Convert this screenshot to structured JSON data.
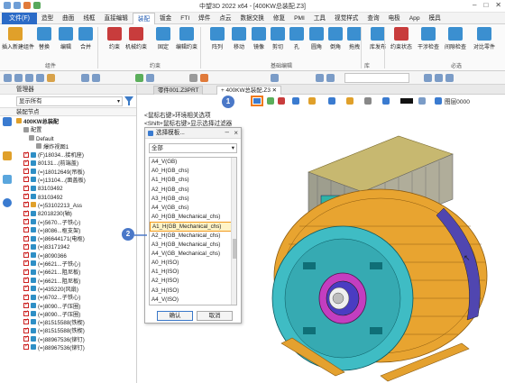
{
  "window": {
    "title": "中望3D 2022 x64 - [400KW总装配.Z3]"
  },
  "menubar": {
    "file": "文件(F)",
    "items": [
      "造型",
      "曲面",
      "线框",
      "直接编辑",
      "装配",
      "钣金",
      "FTI",
      "焊件",
      "点云",
      "数据交换",
      "修复",
      "PMI",
      "工具",
      "视觉样式",
      "查询",
      "电极",
      "App",
      "模具"
    ],
    "active_index": 4
  },
  "ribbon": {
    "buttons": [
      {
        "label": "插入新建组件",
        "icon": "insert-component-icon",
        "color": "#e0a02a"
      },
      {
        "label": "替换",
        "icon": "replace-icon",
        "color": "#3b8fd0"
      },
      {
        "label": "编辑",
        "icon": "edit-icon",
        "color": "#3b8fd0"
      },
      {
        "label": "合并",
        "icon": "merge-icon",
        "color": "#3b8fd0"
      },
      {
        "label": "约束",
        "icon": "constraint-icon",
        "color": "#c83c3c"
      },
      {
        "label": "机械约束",
        "icon": "mechanical-constraint-icon",
        "color": "#c83c3c"
      },
      {
        "label": "固定",
        "icon": "fix-icon",
        "color": "#3b8fd0"
      },
      {
        "label": "编辑约束",
        "icon": "edit-constraint-icon",
        "color": "#3b8fd0"
      },
      {
        "label": "阵列",
        "icon": "pattern-icon",
        "color": "#3b8fd0"
      },
      {
        "label": "移动",
        "icon": "move-icon",
        "color": "#3b8fd0"
      },
      {
        "label": "镜像",
        "icon": "mirror-icon",
        "color": "#3b8fd0"
      },
      {
        "label": "剪切",
        "icon": "cut-icon",
        "color": "#3b8fd0"
      },
      {
        "label": "孔",
        "icon": "hole-icon",
        "color": "#3b8fd0"
      },
      {
        "label": "圆角",
        "icon": "fillet-icon",
        "color": "#3b8fd0"
      },
      {
        "label": "倒角",
        "icon": "chamfer-icon",
        "color": "#3b8fd0"
      },
      {
        "label": "拖拽",
        "icon": "drag-icon",
        "color": "#3b8fd0"
      },
      {
        "label": "库发布",
        "icon": "library-publish-icon",
        "color": "#3b8fd0"
      },
      {
        "label": "约束状态",
        "icon": "constraint-status-icon",
        "color": "#c83c3c"
      },
      {
        "label": "干涉检查",
        "icon": "interference-check-icon",
        "color": "#3b8fd0"
      },
      {
        "label": "间隙检查",
        "icon": "clearance-check-icon",
        "color": "#3b8fd0"
      },
      {
        "label": "对比零件",
        "icon": "compare-parts-icon",
        "color": "#3b8fd0"
      }
    ],
    "groups": [
      "组件",
      "约束",
      "基础编辑",
      "库",
      "必选"
    ]
  },
  "panel": {
    "title": "管理器",
    "filter_value": "显示所有",
    "node_header": "装配节点",
    "tree": [
      {
        "label": "400KW总装配",
        "kind": "root"
      },
      {
        "label": "配置",
        "kind": "cfg"
      },
      {
        "label": "Default",
        "kind": "cfg"
      },
      {
        "label": "爆炸视图1",
        "kind": "cfg"
      },
      {
        "label": "(F)18034...接机座)",
        "kind": "part"
      },
      {
        "label": "80131...(前端盖)",
        "kind": "part"
      },
      {
        "label": "(=)18012649(吊板)",
        "kind": "part"
      },
      {
        "label": "(=)13104...(面盖板)",
        "kind": "part"
      },
      {
        "label": "83103492",
        "kind": "part"
      },
      {
        "label": "83103492",
        "kind": "part"
      },
      {
        "label": "(=)53102213_Ass",
        "kind": "asm"
      },
      {
        "label": "82018230(轴)",
        "kind": "part"
      },
      {
        "label": "(=)5670...子铁心)",
        "kind": "part"
      },
      {
        "label": "(=)8086...枢支架)",
        "kind": "part"
      },
      {
        "label": "(=)86644171(电枢)",
        "kind": "part"
      },
      {
        "label": "(=)83171942",
        "kind": "part"
      },
      {
        "label": "(=)8090366",
        "kind": "part"
      },
      {
        "label": "(=)6621...子铁心)",
        "kind": "part"
      },
      {
        "label": "(=)6621...阻尼板)",
        "kind": "part"
      },
      {
        "label": "(=)6621...阻尼板)",
        "kind": "part"
      },
      {
        "label": "(=)435220(风扇)",
        "kind": "part"
      },
      {
        "label": "(=)6702...子铁心)",
        "kind": "part"
      },
      {
        "label": "(=)8090...子压圈)",
        "kind": "part"
      },
      {
        "label": "(=)8090...子压圈)",
        "kind": "part"
      },
      {
        "label": "(=)81515588(铁楔)",
        "kind": "part"
      },
      {
        "label": "(=)81515588(铁楔)",
        "kind": "part"
      },
      {
        "label": "(=)88967536(铆钉)",
        "kind": "part"
      },
      {
        "label": "(=)88967536(铆钉)",
        "kind": "part"
      }
    ]
  },
  "tabs": [
    {
      "label": "零件001.Z3PRT",
      "active": false
    },
    {
      "label": "400KW总装配.Z3",
      "active": true
    }
  ],
  "viewport": {
    "hint1": "<鼠标右键>环境相关选项",
    "hint2": "<Shift+鼠标右键>显示选择过滤器",
    "layer_label": "图层0000",
    "cursor_glyph": "↖"
  },
  "dialog": {
    "title": "选择模板...",
    "filter_value": "全部",
    "items": [
      "A4_V(GB)",
      "A0_H(GB_chs)",
      "A1_H(GB_chs)",
      "A2_H(GB_chs)",
      "A3_H(GB_chs)",
      "A4_V(GB_chs)",
      "A0_H(GB_Mechanical_chs)",
      "A1_H(GB_Mechanical_chs)",
      "A2_H(GB_Mechanical_chs)",
      "A3_H(GB_Mechanical_chs)",
      "A4_V(GB_Mechanical_chs)",
      "A0_H(ISO)",
      "A1_H(ISO)",
      "A2_H(ISO)",
      "A3_H(ISO)",
      "A4_V(ISO)"
    ],
    "selected_index": 7,
    "ok_label": "确认",
    "cancel_label": "取消"
  },
  "badges": [
    "1",
    "2"
  ]
}
